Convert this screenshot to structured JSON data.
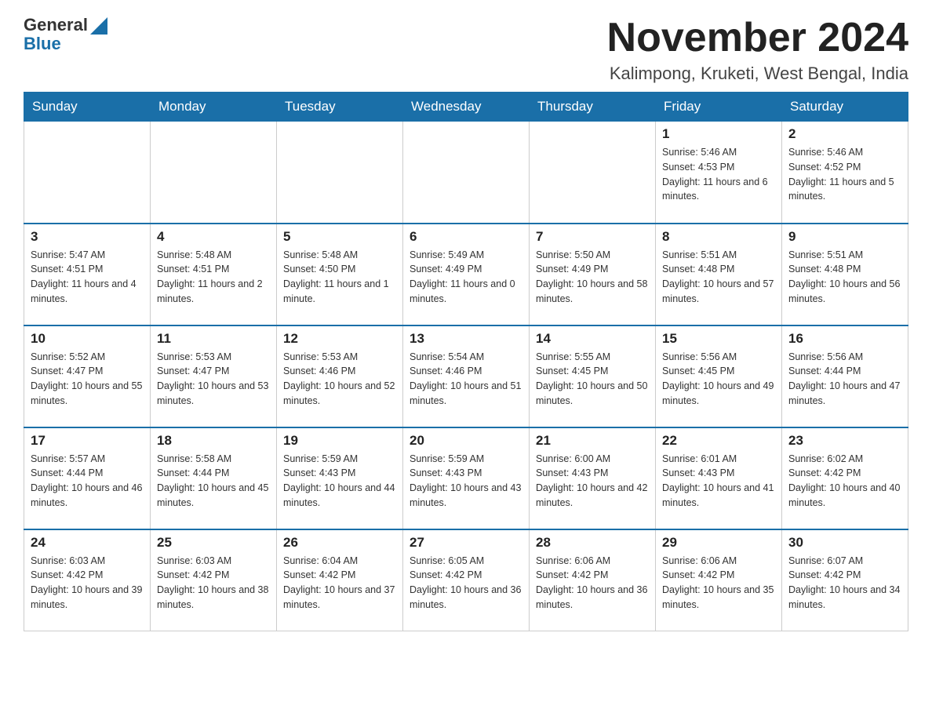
{
  "header": {
    "logo_general": "General",
    "logo_blue": "Blue",
    "month_year": "November 2024",
    "location": "Kalimpong, Kruketi, West Bengal, India"
  },
  "days_of_week": [
    "Sunday",
    "Monday",
    "Tuesday",
    "Wednesday",
    "Thursday",
    "Friday",
    "Saturday"
  ],
  "weeks": [
    [
      {
        "day": "",
        "info": ""
      },
      {
        "day": "",
        "info": ""
      },
      {
        "day": "",
        "info": ""
      },
      {
        "day": "",
        "info": ""
      },
      {
        "day": "",
        "info": ""
      },
      {
        "day": "1",
        "info": "Sunrise: 5:46 AM\nSunset: 4:53 PM\nDaylight: 11 hours and 6 minutes."
      },
      {
        "day": "2",
        "info": "Sunrise: 5:46 AM\nSunset: 4:52 PM\nDaylight: 11 hours and 5 minutes."
      }
    ],
    [
      {
        "day": "3",
        "info": "Sunrise: 5:47 AM\nSunset: 4:51 PM\nDaylight: 11 hours and 4 minutes."
      },
      {
        "day": "4",
        "info": "Sunrise: 5:48 AM\nSunset: 4:51 PM\nDaylight: 11 hours and 2 minutes."
      },
      {
        "day": "5",
        "info": "Sunrise: 5:48 AM\nSunset: 4:50 PM\nDaylight: 11 hours and 1 minute."
      },
      {
        "day": "6",
        "info": "Sunrise: 5:49 AM\nSunset: 4:49 PM\nDaylight: 11 hours and 0 minutes."
      },
      {
        "day": "7",
        "info": "Sunrise: 5:50 AM\nSunset: 4:49 PM\nDaylight: 10 hours and 58 minutes."
      },
      {
        "day": "8",
        "info": "Sunrise: 5:51 AM\nSunset: 4:48 PM\nDaylight: 10 hours and 57 minutes."
      },
      {
        "day": "9",
        "info": "Sunrise: 5:51 AM\nSunset: 4:48 PM\nDaylight: 10 hours and 56 minutes."
      }
    ],
    [
      {
        "day": "10",
        "info": "Sunrise: 5:52 AM\nSunset: 4:47 PM\nDaylight: 10 hours and 55 minutes."
      },
      {
        "day": "11",
        "info": "Sunrise: 5:53 AM\nSunset: 4:47 PM\nDaylight: 10 hours and 53 minutes."
      },
      {
        "day": "12",
        "info": "Sunrise: 5:53 AM\nSunset: 4:46 PM\nDaylight: 10 hours and 52 minutes."
      },
      {
        "day": "13",
        "info": "Sunrise: 5:54 AM\nSunset: 4:46 PM\nDaylight: 10 hours and 51 minutes."
      },
      {
        "day": "14",
        "info": "Sunrise: 5:55 AM\nSunset: 4:45 PM\nDaylight: 10 hours and 50 minutes."
      },
      {
        "day": "15",
        "info": "Sunrise: 5:56 AM\nSunset: 4:45 PM\nDaylight: 10 hours and 49 minutes."
      },
      {
        "day": "16",
        "info": "Sunrise: 5:56 AM\nSunset: 4:44 PM\nDaylight: 10 hours and 47 minutes."
      }
    ],
    [
      {
        "day": "17",
        "info": "Sunrise: 5:57 AM\nSunset: 4:44 PM\nDaylight: 10 hours and 46 minutes."
      },
      {
        "day": "18",
        "info": "Sunrise: 5:58 AM\nSunset: 4:44 PM\nDaylight: 10 hours and 45 minutes."
      },
      {
        "day": "19",
        "info": "Sunrise: 5:59 AM\nSunset: 4:43 PM\nDaylight: 10 hours and 44 minutes."
      },
      {
        "day": "20",
        "info": "Sunrise: 5:59 AM\nSunset: 4:43 PM\nDaylight: 10 hours and 43 minutes."
      },
      {
        "day": "21",
        "info": "Sunrise: 6:00 AM\nSunset: 4:43 PM\nDaylight: 10 hours and 42 minutes."
      },
      {
        "day": "22",
        "info": "Sunrise: 6:01 AM\nSunset: 4:43 PM\nDaylight: 10 hours and 41 minutes."
      },
      {
        "day": "23",
        "info": "Sunrise: 6:02 AM\nSunset: 4:42 PM\nDaylight: 10 hours and 40 minutes."
      }
    ],
    [
      {
        "day": "24",
        "info": "Sunrise: 6:03 AM\nSunset: 4:42 PM\nDaylight: 10 hours and 39 minutes."
      },
      {
        "day": "25",
        "info": "Sunrise: 6:03 AM\nSunset: 4:42 PM\nDaylight: 10 hours and 38 minutes."
      },
      {
        "day": "26",
        "info": "Sunrise: 6:04 AM\nSunset: 4:42 PM\nDaylight: 10 hours and 37 minutes."
      },
      {
        "day": "27",
        "info": "Sunrise: 6:05 AM\nSunset: 4:42 PM\nDaylight: 10 hours and 36 minutes."
      },
      {
        "day": "28",
        "info": "Sunrise: 6:06 AM\nSunset: 4:42 PM\nDaylight: 10 hours and 36 minutes."
      },
      {
        "day": "29",
        "info": "Sunrise: 6:06 AM\nSunset: 4:42 PM\nDaylight: 10 hours and 35 minutes."
      },
      {
        "day": "30",
        "info": "Sunrise: 6:07 AM\nSunset: 4:42 PM\nDaylight: 10 hours and 34 minutes."
      }
    ]
  ]
}
